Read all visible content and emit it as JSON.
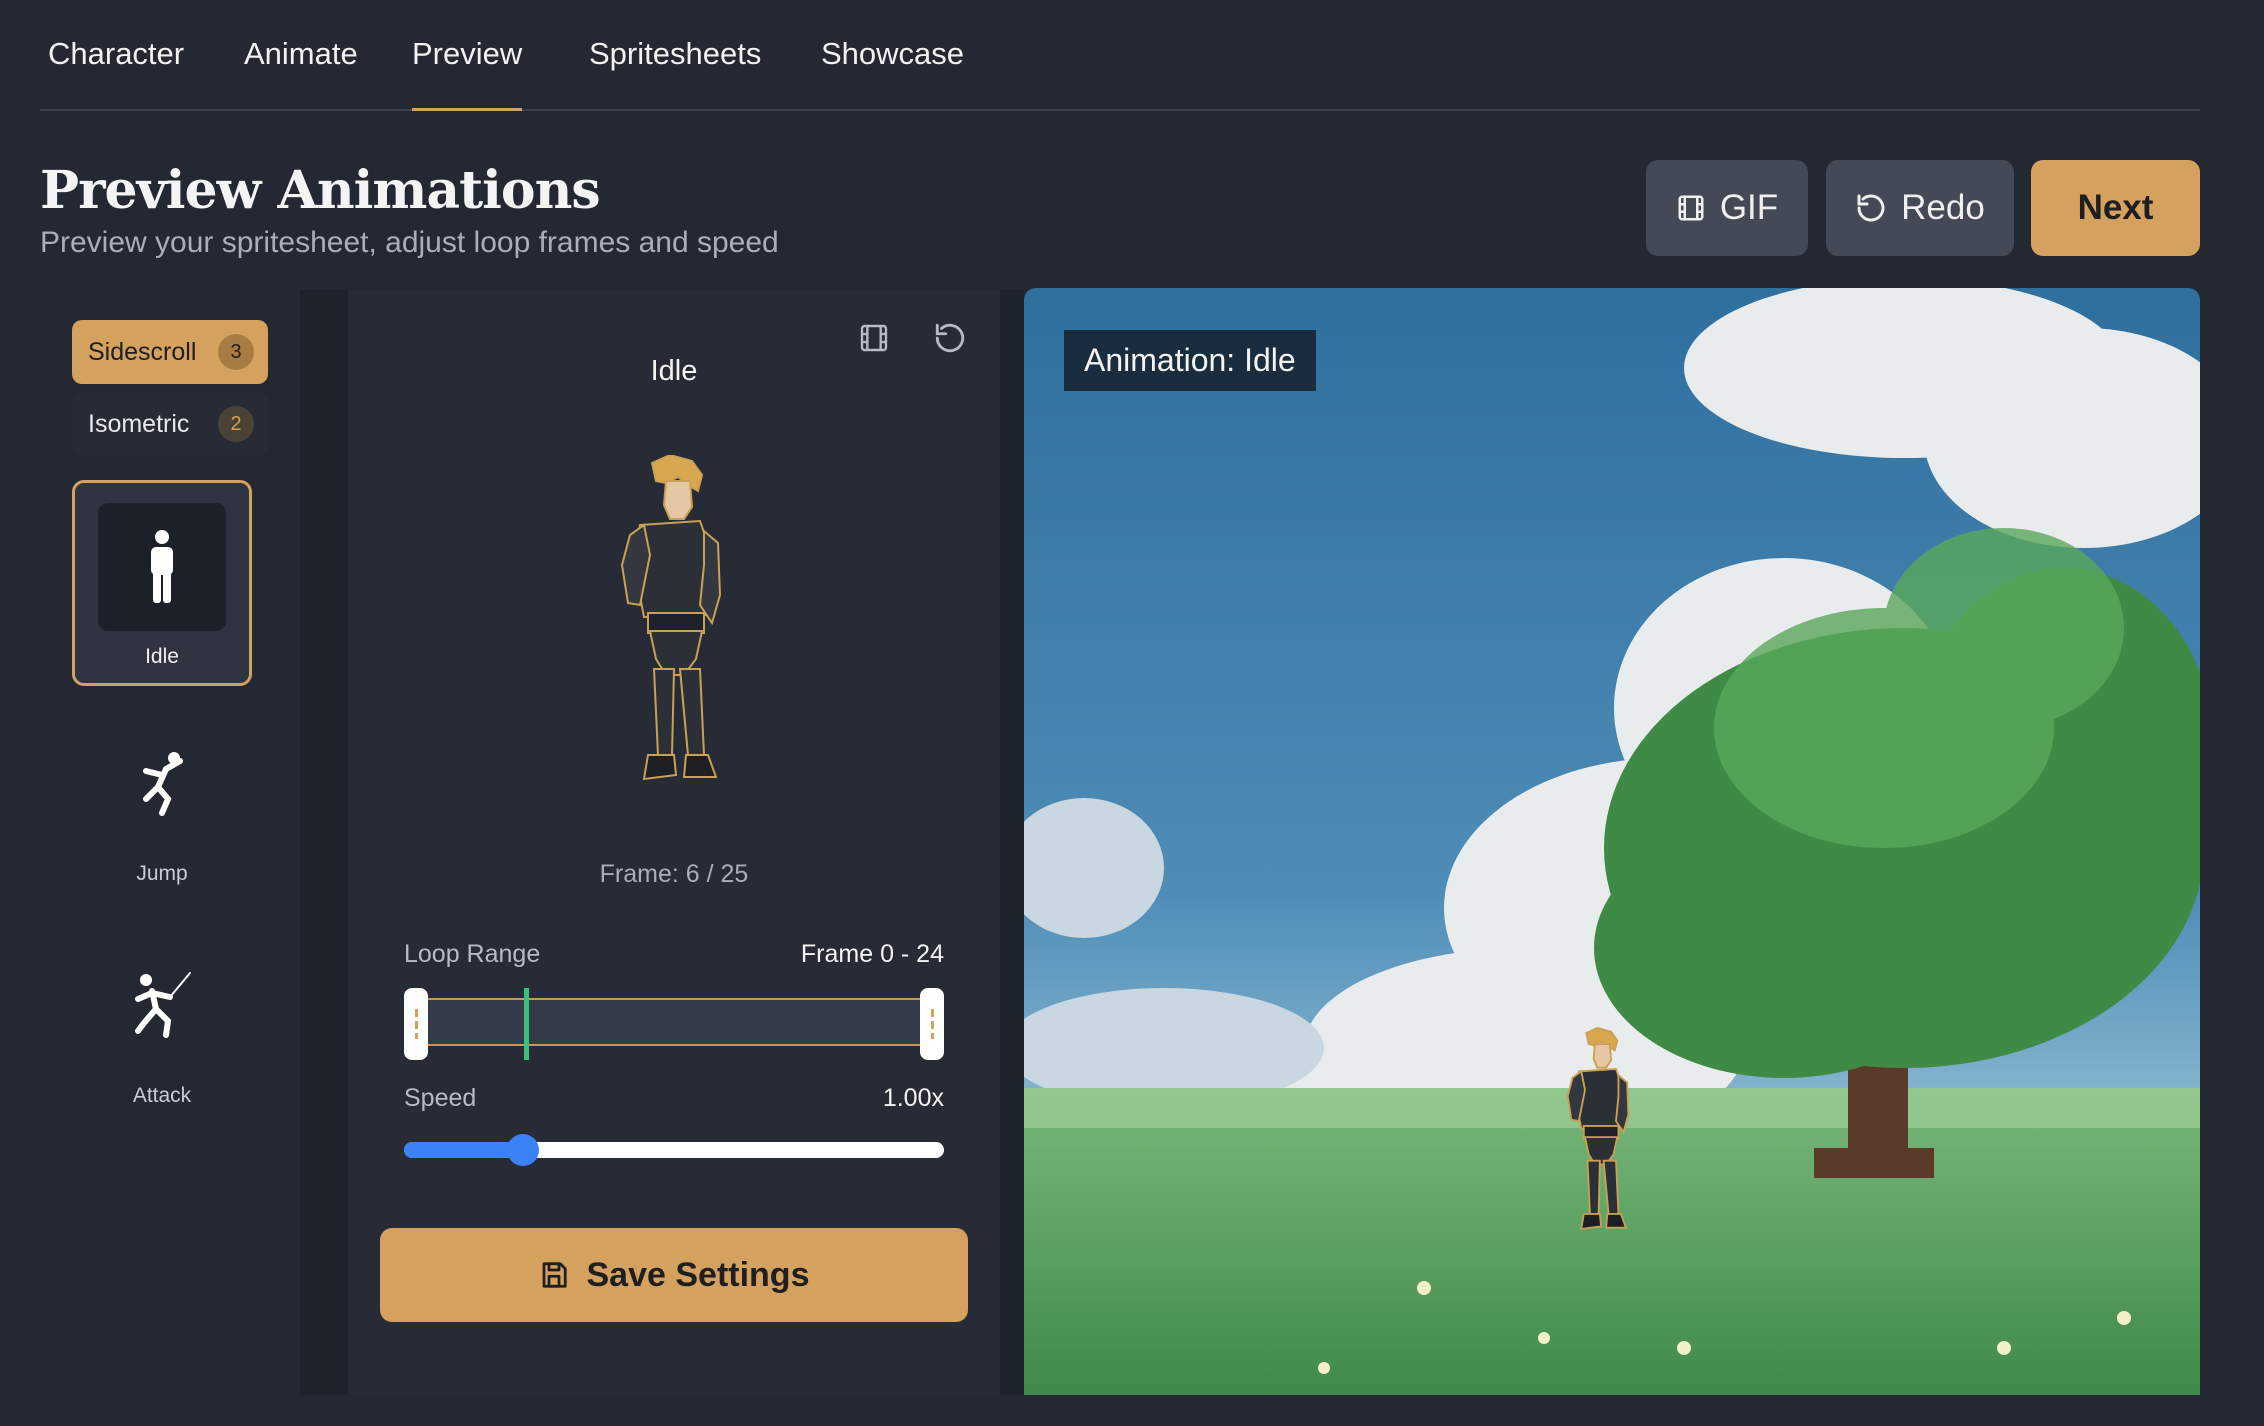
{
  "tabs": [
    {
      "label": "Character"
    },
    {
      "label": "Animate"
    },
    {
      "label": "Preview"
    },
    {
      "label": "Spritesheets"
    },
    {
      "label": "Showcase"
    }
  ],
  "active_tab": "Preview",
  "header": {
    "title": "Preview Animations",
    "subtitle": "Preview your spritesheet, adjust loop frames and speed",
    "gif_label": "GIF",
    "redo_label": "Redo",
    "next_label": "Next"
  },
  "modes": [
    {
      "label": "Sidescroll",
      "count": "3",
      "active": true
    },
    {
      "label": "Isometric",
      "count": "2",
      "active": false
    }
  ],
  "animations": [
    {
      "label": "Idle",
      "icon": "person-standing-icon",
      "selected": true
    },
    {
      "label": "Jump",
      "icon": "person-jumping-icon",
      "selected": false
    },
    {
      "label": "Attack",
      "icon": "person-fencing-icon",
      "selected": false
    }
  ],
  "preview": {
    "title": "Idle",
    "frame_text": "Frame: 6 / 25",
    "current_frame": 6,
    "total_frames": 25,
    "loop_label": "Loop Range",
    "loop_value": "Frame 0 - 24",
    "loop_start": 0,
    "loop_end": 24,
    "speed_label": "Speed",
    "speed_value": "1.00x",
    "speed_fraction": 0.22,
    "save_label": "Save Settings"
  },
  "scene": {
    "tag": "Animation: Idle"
  },
  "colors": {
    "accent": "#d4a15e",
    "background": "#232833",
    "panel": "#262b36",
    "slider": "#3b82f6",
    "playhead": "#3fc07a"
  }
}
